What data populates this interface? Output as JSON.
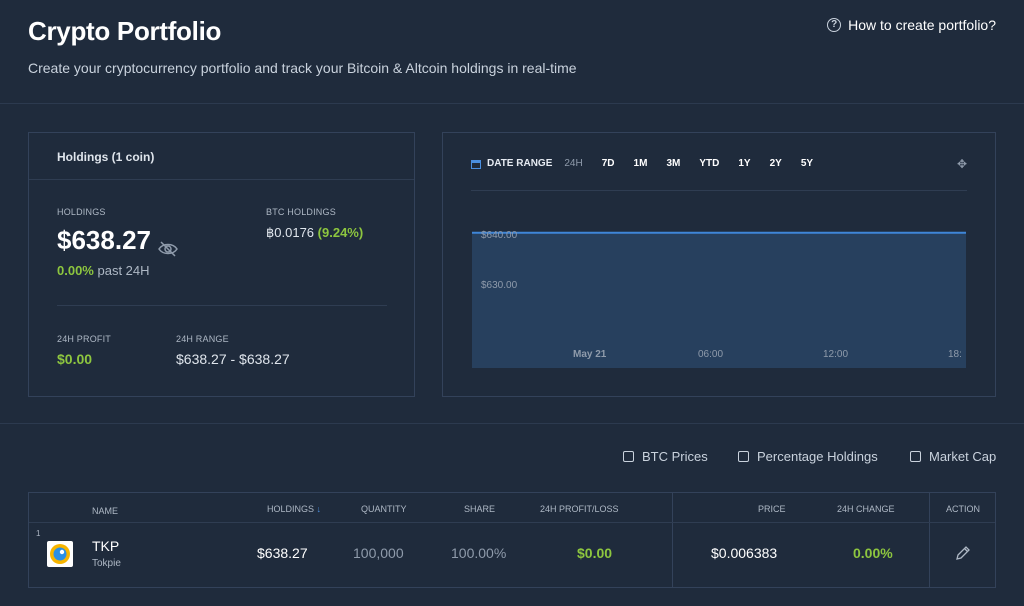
{
  "header": {
    "title": "Crypto Portfolio",
    "subtitle": "Create your cryptocurrency portfolio and track your Bitcoin & Altcoin holdings in real-time",
    "help_link": "How to create portfolio?"
  },
  "holdings": {
    "panel_title": "Holdings (1 coin)",
    "holdings_label": "HOLDINGS",
    "holdings_value": "$638.27",
    "change_pct": "0.00%",
    "change_period": "past 24H",
    "btc_label": "BTC HOLDINGS",
    "btc_value": "฿0.0176",
    "btc_pct": "(9.24%)",
    "profit_label": "24H PROFIT",
    "profit_value": "$0.00",
    "range_label": "24H RANGE",
    "range_value": "$638.27 - $638.27"
  },
  "chart_toolbar": {
    "date_range_label": "DATE RANGE",
    "ranges": [
      "24H",
      "7D",
      "1M",
      "3M",
      "YTD",
      "1Y",
      "2Y",
      "5Y"
    ],
    "active_range": "24H"
  },
  "chart_data": {
    "type": "area",
    "x_tick_labels": [
      "May 21",
      "06:00",
      "12:00",
      "18:"
    ],
    "y_tick_labels": [
      "$640.00",
      "$630.00"
    ],
    "ylim": [
      620,
      642
    ],
    "x": [
      0,
      1
    ],
    "values": [
      638.27,
      638.27
    ],
    "line_color": "#3f86d8",
    "fill_color": "#27405e"
  },
  "options": {
    "btc_prices": "BTC Prices",
    "percentage_holdings": "Percentage Holdings",
    "market_cap": "Market Cap"
  },
  "table": {
    "headers": {
      "name": "NAME",
      "holdings": "HOLDINGS",
      "quantity": "QUANTITY",
      "share": "SHARE",
      "profit": "24H PROFIT/LOSS",
      "price": "PRICE",
      "change": "24H CHANGE",
      "action": "ACTION"
    },
    "rows": [
      {
        "rank": "1",
        "symbol": "TKP",
        "name": "Tokpie",
        "holdings": "$638.27",
        "quantity": "100,000",
        "share": "100.00%",
        "profit": "$0.00",
        "price": "$0.006383",
        "change": "0.00%"
      }
    ]
  }
}
